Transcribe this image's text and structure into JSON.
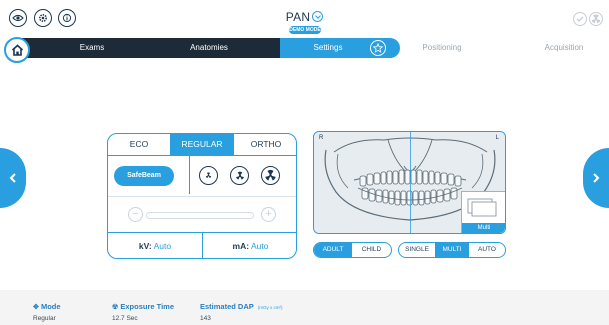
{
  "header": {
    "title": "PAN",
    "badge": "DEMO MODE"
  },
  "nav": {
    "tabs": [
      {
        "label": "Exams"
      },
      {
        "label": "Anatomies"
      },
      {
        "label": "Settings"
      },
      {
        "label": "Positioning"
      },
      {
        "label": "Acquisition"
      }
    ]
  },
  "settings": {
    "modes": [
      "ECO",
      "REGULAR",
      "ORTHO"
    ],
    "selected_mode": "REGULAR",
    "safebeam_label": "SafeBeam",
    "kv_label": "kV:",
    "kv_value": "Auto",
    "ma_label": "mA:",
    "ma_value": "Auto"
  },
  "image": {
    "left_marker": "R",
    "right_marker": "L",
    "thumb_label": "Multi"
  },
  "patient_size": {
    "options": [
      "ADULT",
      "CHILD"
    ],
    "selected": "ADULT"
  },
  "acq_mode": {
    "options": [
      "SINGLE",
      "MULTI",
      "AUTO"
    ],
    "selected": "MULTI"
  },
  "info": {
    "mode": {
      "label": "Mode",
      "value": "Regular"
    },
    "exposure": {
      "label": "Exposure Time",
      "value": "12.7 Sec"
    },
    "dap": {
      "label": "Estimated DAP",
      "unit": "(mGy x cm²)",
      "value": "143"
    }
  },
  "colors": {
    "accent": "#2a9fdf",
    "dark_nav": "#1d2a38",
    "text": "#1f3c57"
  }
}
